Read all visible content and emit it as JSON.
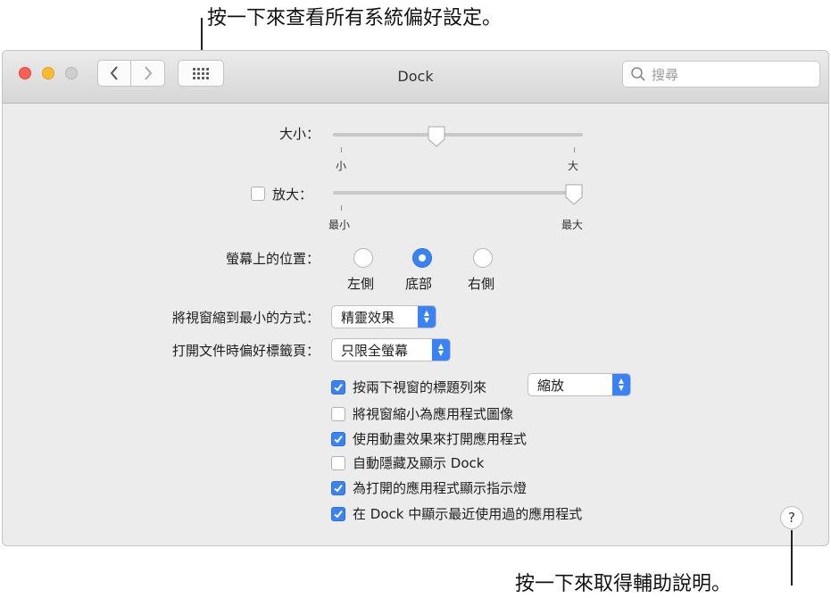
{
  "callouts": {
    "top": "按一下來查看所有系統偏好設定。",
    "bottom": "按一下來取得輔助說明。"
  },
  "window": {
    "title": "Dock",
    "search_placeholder": "搜尋",
    "icons": {
      "back": "chevron-left-icon",
      "forward": "chevron-right-icon",
      "show_all": "grid-icon",
      "search": "magnifier-icon"
    }
  },
  "size": {
    "label": "大小：",
    "min_label": "小",
    "max_label": "大",
    "value_fraction": 0.43
  },
  "magnification": {
    "label": "放大：",
    "checked": false,
    "min_label": "最小",
    "max_label": "最大",
    "value_fraction": 1.0
  },
  "position": {
    "label": "螢幕上的位置：",
    "options": [
      "左側",
      "底部",
      "右側"
    ],
    "selected": "底部"
  },
  "minimize_effect": {
    "label": "將視窗縮到最小的方式：",
    "value": "精靈效果"
  },
  "prefer_tabs": {
    "label": "打開文件時偏好標籤頁：",
    "value": "只限全螢幕"
  },
  "double_click": {
    "label": "按兩下視窗的標題列來",
    "checked": true,
    "value": "縮放"
  },
  "checkboxes": [
    {
      "label": "將視窗縮小為應用程式圖像",
      "checked": false
    },
    {
      "label": "使用動畫效果來打開應用程式",
      "checked": true
    },
    {
      "label": "自動隱藏及顯示 Dock",
      "checked": false
    },
    {
      "label": "為打開的應用程式顯示指示燈",
      "checked": true
    },
    {
      "label": "在 Dock 中顯示最近使用過的應用程式",
      "checked": true
    }
  ],
  "help_button": "?",
  "colors": {
    "accent": "#3b82f6",
    "window_bg": "#ececec",
    "close": "#fc5f57",
    "minimize": "#fdbc2e",
    "zoom_disabled": "#cfcfcf"
  }
}
